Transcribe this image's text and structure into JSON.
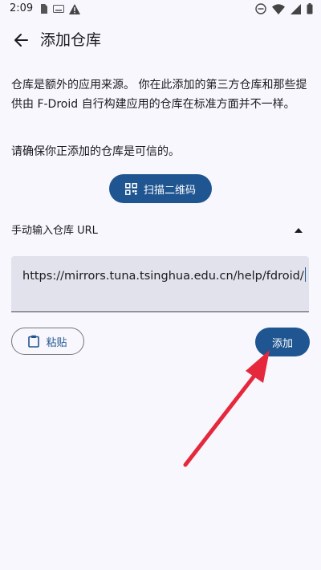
{
  "status_bar": {
    "time": "2:09",
    "icons": [
      "sim-icon",
      "keyboard-icon",
      "warning-icon",
      "dnd-icon",
      "wifi-icon",
      "signal-icon",
      "battery-icon"
    ]
  },
  "app_bar": {
    "title": "添加仓库",
    "back_icon": "arrow-back-icon"
  },
  "content": {
    "description": "仓库是额外的应用来源。 你在此添加的第三方仓库和那些提供由 F-Droid 自行构建应用的仓库在标准方面并不一样。",
    "warning": "请确保你正添加的仓库是可信的。",
    "scan_button_label": "扫描二维码",
    "manual_label": "手动输入仓库 URL",
    "url_value": "https://mirrors.tuna.tsinghua.edu.cn/help/fdroid/",
    "paste_button_label": "粘贴",
    "add_button_label": "添加"
  },
  "colors": {
    "primary": "#1f5590",
    "background": "#f8f7fd",
    "field": "#e1e2ec",
    "annotation_arrow": "#e5283c"
  }
}
